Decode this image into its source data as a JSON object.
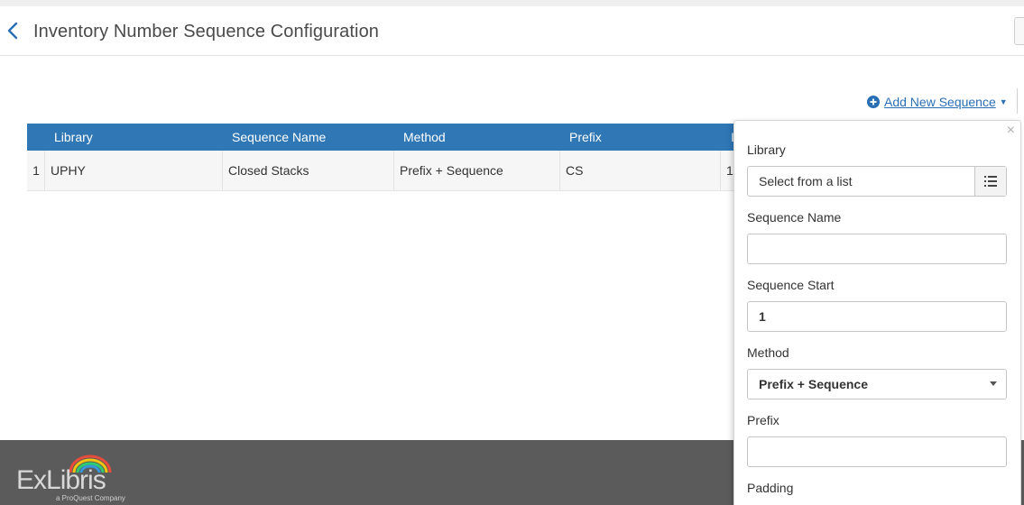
{
  "header": {
    "title": "Inventory Number Sequence Configuration",
    "back_icon": "chevron-left-icon"
  },
  "toolbar": {
    "add_new_label": "Add New Sequence",
    "add_icon": "plus-circle-icon",
    "caret_icon": "caret-down-icon"
  },
  "table": {
    "columns": [
      "Library",
      "Sequence Name",
      "Method",
      "Prefix",
      "I"
    ],
    "rows": [
      {
        "num": "1",
        "library": "UPHY",
        "sequence_name": "Closed Stacks",
        "method": "Prefix + Sequence",
        "prefix": "CS",
        "extra": "1"
      }
    ]
  },
  "panel": {
    "close": "×",
    "library_label": "Library",
    "library_placeholder": "Select from a list",
    "sequence_name_label": "Sequence Name",
    "sequence_name_value": "",
    "sequence_start_label": "Sequence Start",
    "sequence_start_value": "1",
    "method_label": "Method",
    "method_value": "Prefix + Sequence",
    "prefix_label": "Prefix",
    "prefix_value": "",
    "padding_label": "Padding"
  },
  "footer": {
    "logo_text": "ExLibris",
    "logo_sub": "a ProQuest Company"
  },
  "colors": {
    "accent": "#2f77b5",
    "link": "#2a6fb5",
    "footer": "#5b5b5b"
  }
}
